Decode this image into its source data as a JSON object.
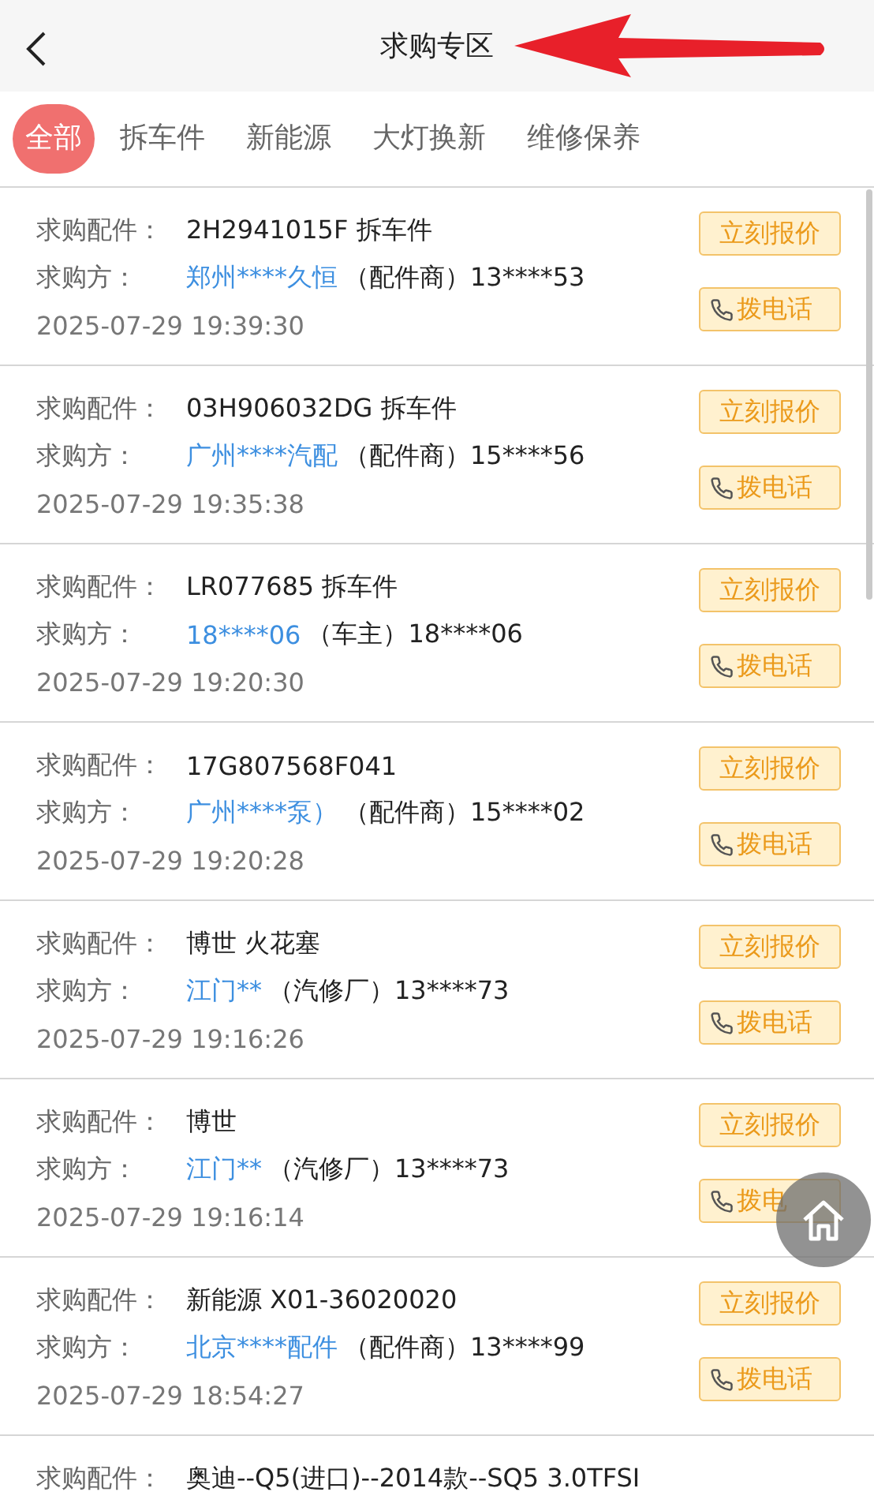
{
  "header": {
    "title": "求购专区"
  },
  "tabs": [
    {
      "label": "全部",
      "selected": true
    },
    {
      "label": "拆车件",
      "selected": false
    },
    {
      "label": "新能源",
      "selected": false
    },
    {
      "label": "大灯换新",
      "selected": false
    },
    {
      "label": "维修保养",
      "selected": false
    }
  ],
  "requests": [
    {
      "part_label": "求购配件：",
      "part": "2H2941015F 拆车件",
      "buyer_label": "求购方：",
      "buyer": "郑州****久恒",
      "buyer_info": "（配件商）13****53",
      "time": "2025-07-29 19:39:30",
      "quote_button": "立刻报价",
      "call_button": "拨电话"
    },
    {
      "part_label": "求购配件：",
      "part": "03H906032DG 拆车件",
      "buyer_label": "求购方：",
      "buyer": "广州****汽配",
      "buyer_info": "（配件商）15****56",
      "time": "2025-07-29 19:35:38",
      "quote_button": "立刻报价",
      "call_button": "拨电话"
    },
    {
      "part_label": "求购配件：",
      "part": "LR077685 拆车件",
      "buyer_label": "求购方：",
      "buyer": "18****06",
      "buyer_info": "（车主）18****06",
      "time": "2025-07-29 19:20:30",
      "quote_button": "立刻报价",
      "call_button": "拨电话"
    },
    {
      "part_label": "求购配件：",
      "part": "17G807568F041",
      "buyer_label": "求购方：",
      "buyer": "广州****泵）",
      "buyer_info": "（配件商）15****02",
      "time": "2025-07-29 19:20:28",
      "quote_button": "立刻报价",
      "call_button": "拨电话"
    },
    {
      "part_label": "求购配件：",
      "part": "博世 火花塞",
      "buyer_label": "求购方：",
      "buyer": "江门**",
      "buyer_info": "（汽修厂）13****73",
      "time": "2025-07-29 19:16:26",
      "quote_button": "立刻报价",
      "call_button": "拨电话"
    },
    {
      "part_label": "求购配件：",
      "part": "博世",
      "buyer_label": "求购方：",
      "buyer": "江门**",
      "buyer_info": "（汽修厂）13****73",
      "time": "2025-07-29 19:16:14",
      "quote_button": "立刻报价",
      "call_button": "拨电"
    },
    {
      "part_label": "求购配件：",
      "part": "新能源 X01-36020020",
      "buyer_label": "求购方：",
      "buyer": "北京****配件",
      "buyer_info": "（配件商）13****99",
      "time": "2025-07-29 18:54:27",
      "quote_button": "立刻报价",
      "call_button": "拨电话"
    },
    {
      "part_label": "求购配件：",
      "part": "奥迪--Q5(进口)--2014款--SQ5 3.0TFSI"
    }
  ]
}
